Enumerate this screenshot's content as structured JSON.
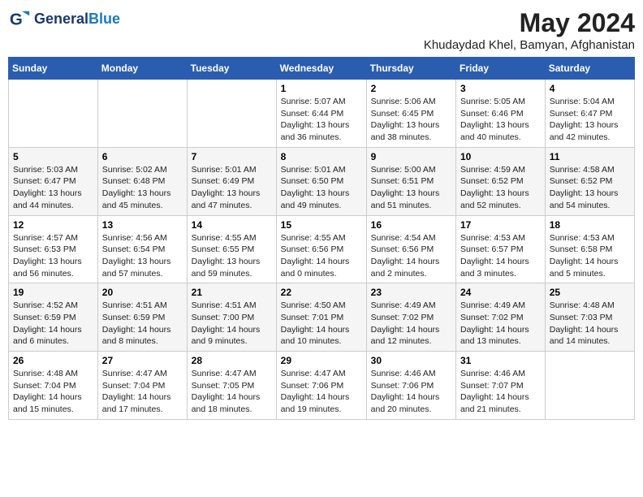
{
  "header": {
    "logo_line1": "General",
    "logo_line2": "Blue",
    "month": "May 2024",
    "location": "Khudaydad Khel, Bamyan, Afghanistan"
  },
  "weekdays": [
    "Sunday",
    "Monday",
    "Tuesday",
    "Wednesday",
    "Thursday",
    "Friday",
    "Saturday"
  ],
  "weeks": [
    [
      {
        "day": "",
        "info": ""
      },
      {
        "day": "",
        "info": ""
      },
      {
        "day": "",
        "info": ""
      },
      {
        "day": "1",
        "info": "Sunrise: 5:07 AM\nSunset: 6:44 PM\nDaylight: 13 hours\nand 36 minutes."
      },
      {
        "day": "2",
        "info": "Sunrise: 5:06 AM\nSunset: 6:45 PM\nDaylight: 13 hours\nand 38 minutes."
      },
      {
        "day": "3",
        "info": "Sunrise: 5:05 AM\nSunset: 6:46 PM\nDaylight: 13 hours\nand 40 minutes."
      },
      {
        "day": "4",
        "info": "Sunrise: 5:04 AM\nSunset: 6:47 PM\nDaylight: 13 hours\nand 42 minutes."
      }
    ],
    [
      {
        "day": "5",
        "info": "Sunrise: 5:03 AM\nSunset: 6:47 PM\nDaylight: 13 hours\nand 44 minutes."
      },
      {
        "day": "6",
        "info": "Sunrise: 5:02 AM\nSunset: 6:48 PM\nDaylight: 13 hours\nand 45 minutes."
      },
      {
        "day": "7",
        "info": "Sunrise: 5:01 AM\nSunset: 6:49 PM\nDaylight: 13 hours\nand 47 minutes."
      },
      {
        "day": "8",
        "info": "Sunrise: 5:01 AM\nSunset: 6:50 PM\nDaylight: 13 hours\nand 49 minutes."
      },
      {
        "day": "9",
        "info": "Sunrise: 5:00 AM\nSunset: 6:51 PM\nDaylight: 13 hours\nand 51 minutes."
      },
      {
        "day": "10",
        "info": "Sunrise: 4:59 AM\nSunset: 6:52 PM\nDaylight: 13 hours\nand 52 minutes."
      },
      {
        "day": "11",
        "info": "Sunrise: 4:58 AM\nSunset: 6:52 PM\nDaylight: 13 hours\nand 54 minutes."
      }
    ],
    [
      {
        "day": "12",
        "info": "Sunrise: 4:57 AM\nSunset: 6:53 PM\nDaylight: 13 hours\nand 56 minutes."
      },
      {
        "day": "13",
        "info": "Sunrise: 4:56 AM\nSunset: 6:54 PM\nDaylight: 13 hours\nand 57 minutes."
      },
      {
        "day": "14",
        "info": "Sunrise: 4:55 AM\nSunset: 6:55 PM\nDaylight: 13 hours\nand 59 minutes."
      },
      {
        "day": "15",
        "info": "Sunrise: 4:55 AM\nSunset: 6:56 PM\nDaylight: 14 hours\nand 0 minutes."
      },
      {
        "day": "16",
        "info": "Sunrise: 4:54 AM\nSunset: 6:56 PM\nDaylight: 14 hours\nand 2 minutes."
      },
      {
        "day": "17",
        "info": "Sunrise: 4:53 AM\nSunset: 6:57 PM\nDaylight: 14 hours\nand 3 minutes."
      },
      {
        "day": "18",
        "info": "Sunrise: 4:53 AM\nSunset: 6:58 PM\nDaylight: 14 hours\nand 5 minutes."
      }
    ],
    [
      {
        "day": "19",
        "info": "Sunrise: 4:52 AM\nSunset: 6:59 PM\nDaylight: 14 hours\nand 6 minutes."
      },
      {
        "day": "20",
        "info": "Sunrise: 4:51 AM\nSunset: 6:59 PM\nDaylight: 14 hours\nand 8 minutes."
      },
      {
        "day": "21",
        "info": "Sunrise: 4:51 AM\nSunset: 7:00 PM\nDaylight: 14 hours\nand 9 minutes."
      },
      {
        "day": "22",
        "info": "Sunrise: 4:50 AM\nSunset: 7:01 PM\nDaylight: 14 hours\nand 10 minutes."
      },
      {
        "day": "23",
        "info": "Sunrise: 4:49 AM\nSunset: 7:02 PM\nDaylight: 14 hours\nand 12 minutes."
      },
      {
        "day": "24",
        "info": "Sunrise: 4:49 AM\nSunset: 7:02 PM\nDaylight: 14 hours\nand 13 minutes."
      },
      {
        "day": "25",
        "info": "Sunrise: 4:48 AM\nSunset: 7:03 PM\nDaylight: 14 hours\nand 14 minutes."
      }
    ],
    [
      {
        "day": "26",
        "info": "Sunrise: 4:48 AM\nSunset: 7:04 PM\nDaylight: 14 hours\nand 15 minutes."
      },
      {
        "day": "27",
        "info": "Sunrise: 4:47 AM\nSunset: 7:04 PM\nDaylight: 14 hours\nand 17 minutes."
      },
      {
        "day": "28",
        "info": "Sunrise: 4:47 AM\nSunset: 7:05 PM\nDaylight: 14 hours\nand 18 minutes."
      },
      {
        "day": "29",
        "info": "Sunrise: 4:47 AM\nSunset: 7:06 PM\nDaylight: 14 hours\nand 19 minutes."
      },
      {
        "day": "30",
        "info": "Sunrise: 4:46 AM\nSunset: 7:06 PM\nDaylight: 14 hours\nand 20 minutes."
      },
      {
        "day": "31",
        "info": "Sunrise: 4:46 AM\nSunset: 7:07 PM\nDaylight: 14 hours\nand 21 minutes."
      },
      {
        "day": "",
        "info": ""
      }
    ]
  ]
}
